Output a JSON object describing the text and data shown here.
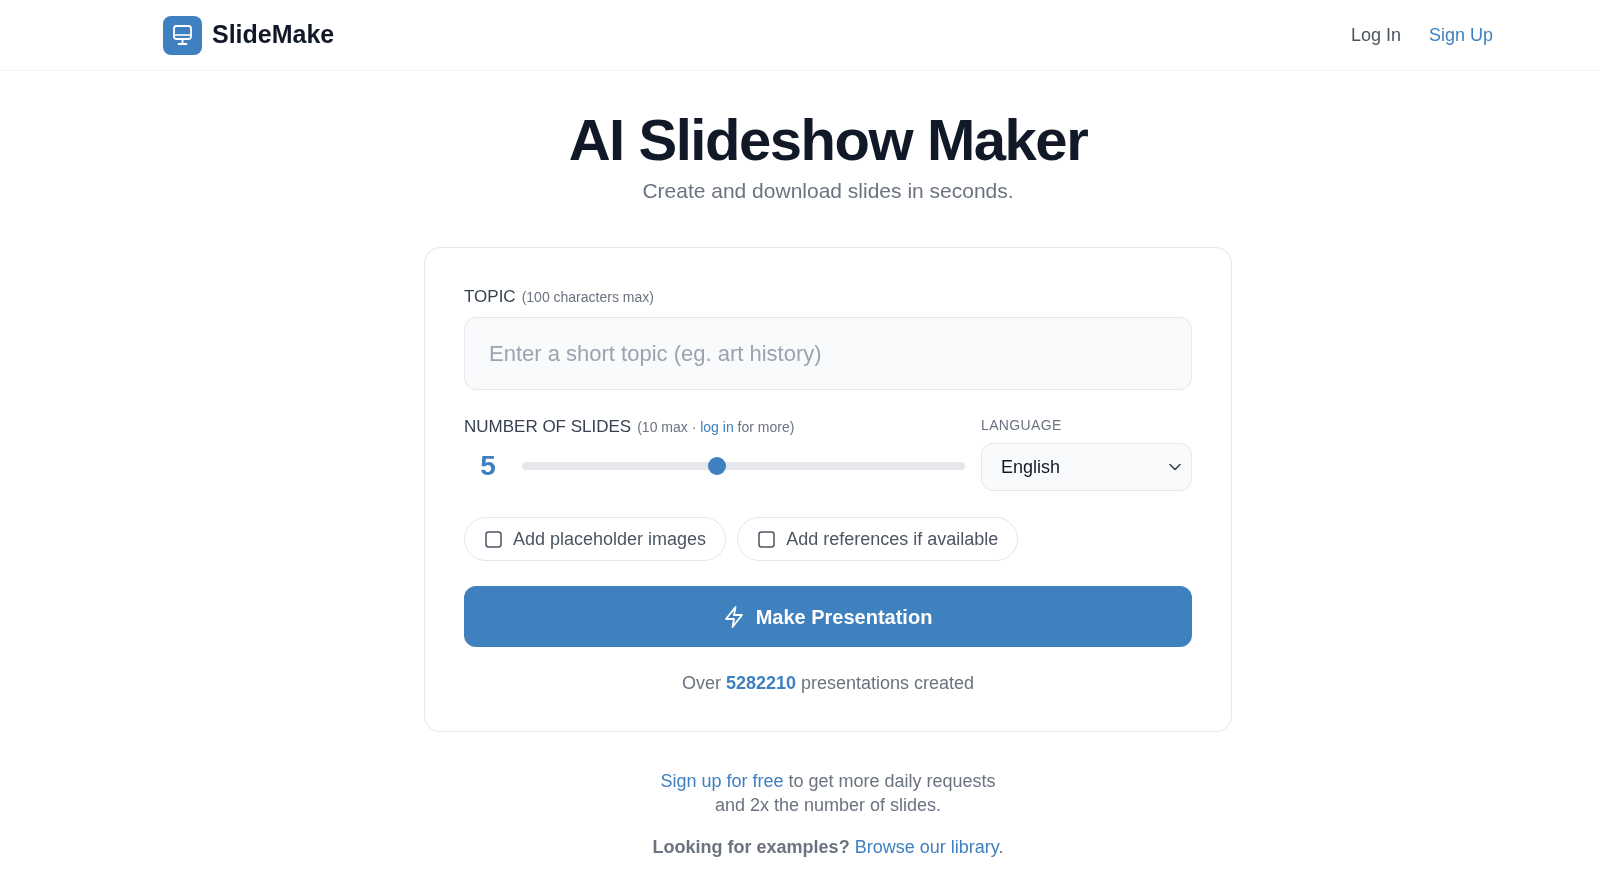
{
  "header": {
    "logo": {
      "text": "SlideMake"
    },
    "nav": [
      {
        "label": "Log In",
        "kind": "plain"
      },
      {
        "label": "Sign Up",
        "kind": "accent"
      }
    ]
  },
  "hero": {
    "title": "AI Slideshow Maker",
    "subtitle": "Create and download slides in seconds."
  },
  "form": {
    "topic": {
      "label": "TOPIC",
      "hint": "(100 characters max)",
      "placeholder": "Enter a short topic (eg. art history)"
    },
    "slides": {
      "label": "NUMBER OF SLIDES",
      "hint": {
        "before": "(10 max ·",
        "link": "log in",
        "after": "for more)"
      },
      "value": "5",
      "level": 0.44
    },
    "language": {
      "label": "LANGUAGE",
      "value": "English"
    },
    "options": [
      {
        "label": "Add placeholder images",
        "checked": false
      },
      {
        "label": "Add references if available",
        "checked": false
      }
    ],
    "submit": {
      "label": "Make Presentation"
    },
    "stats": "Over **5282210** presentations created"
  },
  "footer": {
    "signup": {
      "link": "Sign up for free",
      "text": "to get more daily requests and 2x the number of slides."
    },
    "examples": {
      "lead": "**Looking for examples?**",
      "link": "Browse our library",
      "after": "."
    }
  }
}
